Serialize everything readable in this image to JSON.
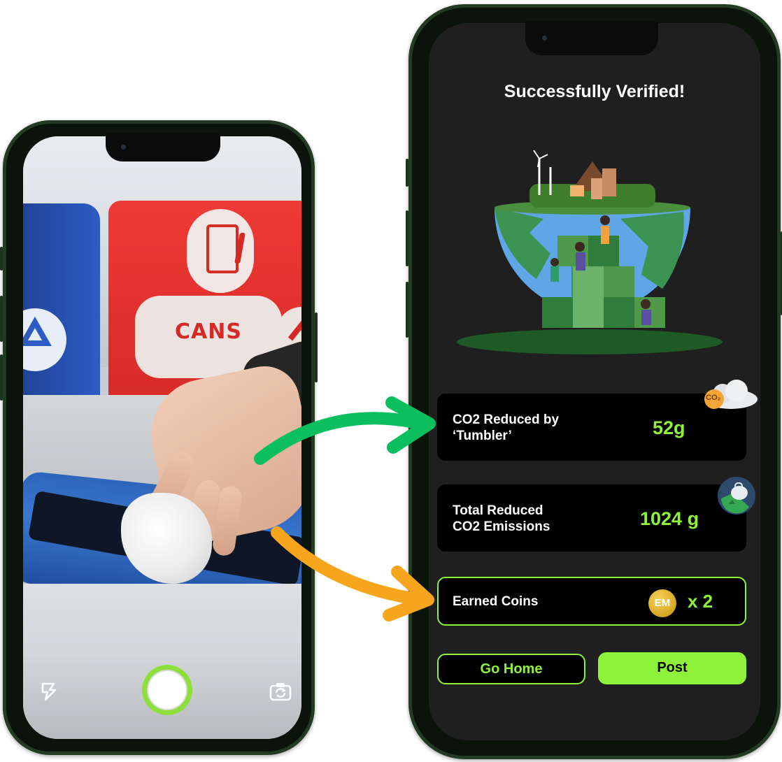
{
  "camera_screen": {
    "bin_label": "CANS"
  },
  "result_screen": {
    "title": "Successfully Verified!",
    "co2_card": {
      "label_line1": "CO2 Reduced by",
      "label_line2": "‘Tumbler’",
      "value": "52g",
      "badge_text": "CO₂"
    },
    "total_card": {
      "label_line1": "Total Reduced",
      "label_line2": "CO2 Emissions",
      "value": "1024 g"
    },
    "coins_card": {
      "label": "Earned Coins",
      "coin_text": "EM",
      "value": "x 2"
    },
    "go_home_label": "Go Home",
    "post_label": "Post"
  },
  "colors": {
    "accent_green": "#8ff23a",
    "arrow_green": "#0bbf5f",
    "arrow_orange": "#f6a51d",
    "screen_bg": "#1f1f1f",
    "card_bg": "#000000"
  },
  "icons": [
    "flash-icon",
    "camera-flip-icon",
    "shutter-button",
    "co2-cloud-icon",
    "earth-bag-icon",
    "em-coin-icon"
  ]
}
